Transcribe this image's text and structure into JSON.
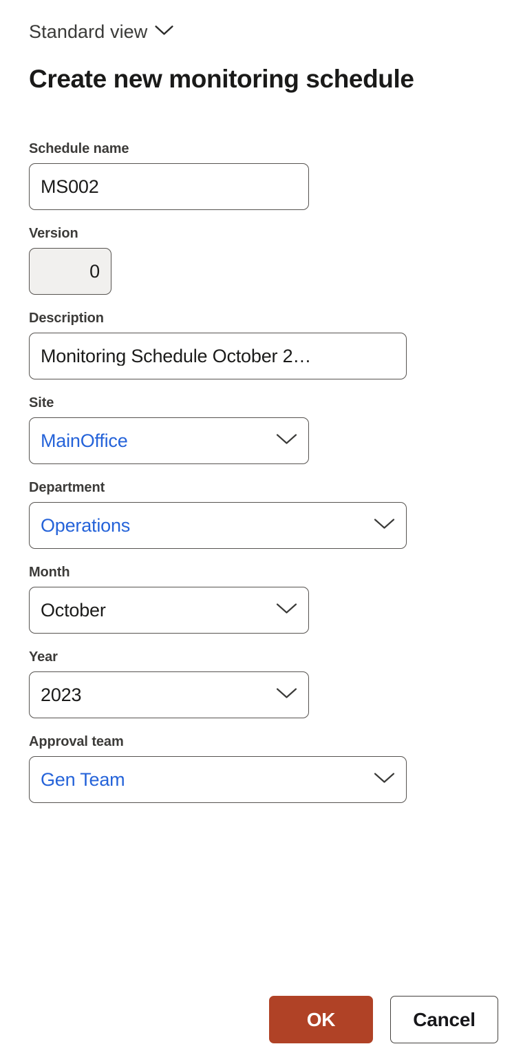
{
  "header": {
    "view_switcher_label": "Standard view",
    "view_switcher_icon": "chevron-down-icon",
    "title": "Create new monitoring schedule"
  },
  "form": {
    "fields": [
      {
        "key": "schedule_name",
        "label": "Schedule name",
        "value": "MS002",
        "type": "text",
        "width": "narrow",
        "value_style": "plain",
        "readonly": false,
        "has_chevron": false
      },
      {
        "key": "version",
        "label": "Version",
        "value": "0",
        "type": "number",
        "width": "tiny",
        "value_style": "plain-right",
        "readonly": true,
        "has_chevron": false
      },
      {
        "key": "description",
        "label": "Description",
        "value": "Monitoring Schedule October 2…",
        "type": "text",
        "width": "wide",
        "value_style": "plain",
        "readonly": false,
        "has_chevron": false
      },
      {
        "key": "site",
        "label": "Site",
        "value": "MainOffice",
        "type": "lookup",
        "width": "narrow",
        "value_style": "link",
        "readonly": false,
        "has_chevron": true
      },
      {
        "key": "department",
        "label": "Department",
        "value": "Operations",
        "type": "lookup",
        "width": "wide",
        "value_style": "link",
        "readonly": false,
        "has_chevron": true
      },
      {
        "key": "month",
        "label": "Month",
        "value": "October",
        "type": "select",
        "width": "narrow",
        "value_style": "plain",
        "readonly": false,
        "has_chevron": true
      },
      {
        "key": "year",
        "label": "Year",
        "value": "2023",
        "type": "select",
        "width": "narrow",
        "value_style": "plain",
        "readonly": false,
        "has_chevron": true
      },
      {
        "key": "approval_team",
        "label": "Approval team",
        "value": "Gen Team",
        "type": "lookup",
        "width": "wide",
        "value_style": "link",
        "readonly": false,
        "has_chevron": true
      }
    ]
  },
  "footer": {
    "ok_label": "OK",
    "cancel_label": "Cancel"
  },
  "colors": {
    "primary_button_background": "#b04226",
    "primary_button_text": "#ffffff",
    "link_value_text": "#2563d9",
    "label_text": "#3c3b39",
    "control_border": "#55524f",
    "readonly_background": "#f1f0ee",
    "page_background": "#ffffff",
    "title_text": "#1a1a19"
  }
}
